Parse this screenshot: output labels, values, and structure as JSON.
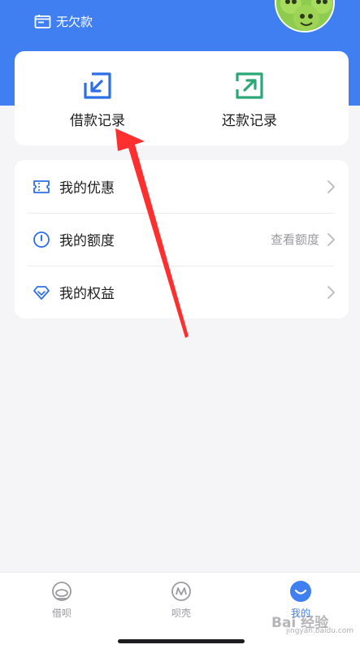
{
  "header": {
    "status_text": "无欠款",
    "accent_color": "#3f7ff2"
  },
  "records": {
    "borrow_label": "借款记录",
    "repay_label": "还款记录"
  },
  "menu": {
    "items": [
      {
        "label": "我的优惠",
        "right_text": "",
        "icon": "ticket-icon"
      },
      {
        "label": "我的额度",
        "right_text": "查看额度",
        "icon": "gauge-icon"
      },
      {
        "label": "我的权益",
        "right_text": "",
        "icon": "diamond-icon"
      }
    ]
  },
  "tabbar": {
    "tabs": [
      {
        "label": "借呗",
        "icon": "borrow-tab-icon",
        "active": false
      },
      {
        "label": "呗壳",
        "icon": "shell-tab-icon",
        "active": false
      },
      {
        "label": "我的",
        "icon": "profile-tab-icon",
        "active": true
      }
    ]
  },
  "watermark": {
    "text": "Bai 经验",
    "sub": "jingyan.baidu.com"
  }
}
